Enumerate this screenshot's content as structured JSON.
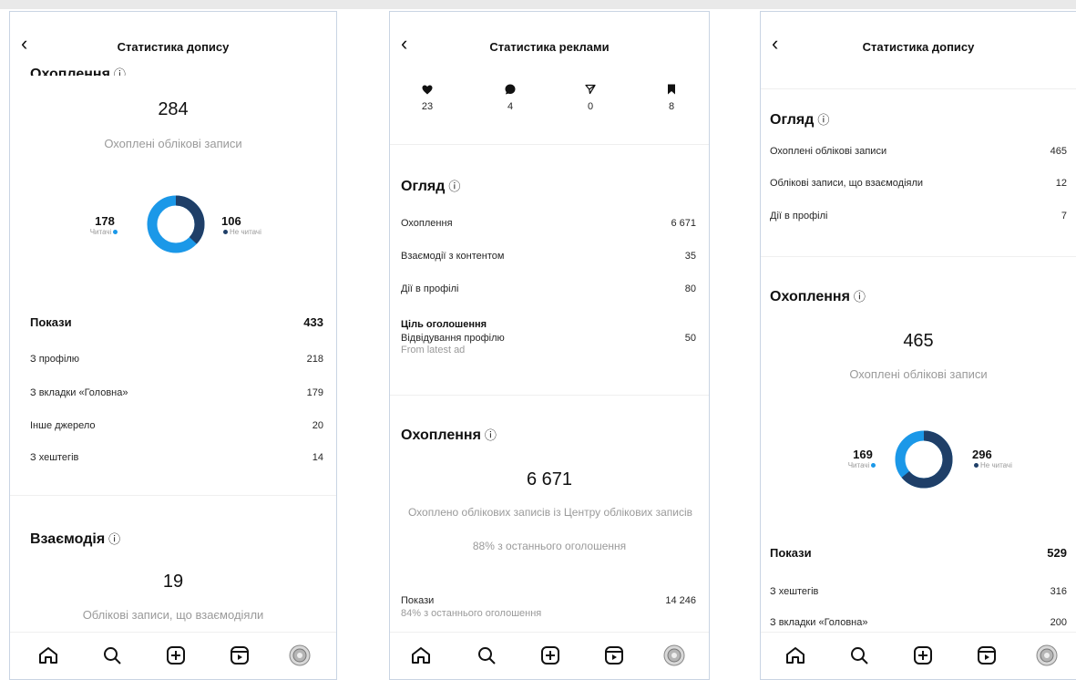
{
  "colors": {
    "dark_blue": "#1f3f68",
    "light_blue": "#1b98e8",
    "text": "#262626",
    "muted": "#9a9a9a"
  },
  "panel1": {
    "title": "Статистика допису",
    "reach_title": "Охоплення",
    "reach_value": "284",
    "reach_sub": "Охоплені облікові записи",
    "followers_value": "178",
    "followers_label": "Читачі",
    "nonfollowers_value": "106",
    "nonfollowers_label": "Не читачі",
    "impressions_label": "Покази",
    "impressions_value": "433",
    "rows": [
      {
        "label": "З профілю",
        "value": "218"
      },
      {
        "label": "З вкладки «Головна»",
        "value": "179"
      },
      {
        "label": "Інше джерело",
        "value": "20"
      },
      {
        "label": "З хештегів",
        "value": "14"
      }
    ],
    "interaction_title": "Взаємодія",
    "interaction_value": "19",
    "interaction_sub": "Облікові записи, що взаємодіяли",
    "donut": {
      "dark_fraction": 0.37
    }
  },
  "panel2": {
    "title": "Статистика реклами",
    "stats": [
      {
        "icon": "heart-icon",
        "value": "23"
      },
      {
        "icon": "comment-icon",
        "value": "4"
      },
      {
        "icon": "share-icon",
        "value": "0"
      },
      {
        "icon": "bookmark-icon",
        "value": "8"
      }
    ],
    "overview_title": "Огляд",
    "rows": [
      {
        "label": "Охоплення",
        "value": "6 671"
      },
      {
        "label": "Взаємодії з контентом",
        "value": "35"
      },
      {
        "label": "Дії в профілі",
        "value": "80"
      }
    ],
    "goal_label": "Ціль оголошення",
    "goal_sub": "Відвідування профілю",
    "goal_note": "From latest ad",
    "goal_value": "50",
    "reach_title": "Охоплення",
    "reach_value": "6 671",
    "reach_sub": "Охоплено облікових записів із Центру облікових записів",
    "reach_sub2": "88% з останнього оголошення",
    "impressions_label": "Покази",
    "impressions_sub": "84% з останнього оголошення",
    "impressions_value": "14 246"
  },
  "panel3": {
    "title": "Статистика допису",
    "overview_title": "Огляд",
    "rows": [
      {
        "label": "Охоплені облікові записи",
        "value": "465"
      },
      {
        "label": "Облікові записи, що взаємодіяли",
        "value": "12"
      },
      {
        "label": "Дії в профілі",
        "value": "7"
      }
    ],
    "reach_title": "Охоплення",
    "reach_value": "465",
    "reach_sub": "Охоплені облікові записи",
    "followers_value": "169",
    "followers_label": "Читачі",
    "nonfollowers_value": "296",
    "nonfollowers_label": "Не читачі",
    "impressions_label": "Покази",
    "impressions_value": "529",
    "imp_rows": [
      {
        "label": "З хештегів",
        "value": "316"
      },
      {
        "label": "З вкладки «Головна»",
        "value": "200"
      }
    ],
    "donut": {
      "dark_fraction": 0.64
    }
  },
  "nav_icons": [
    "home-icon",
    "search-icon",
    "create-icon",
    "reels-icon",
    "profile-avatar"
  ]
}
